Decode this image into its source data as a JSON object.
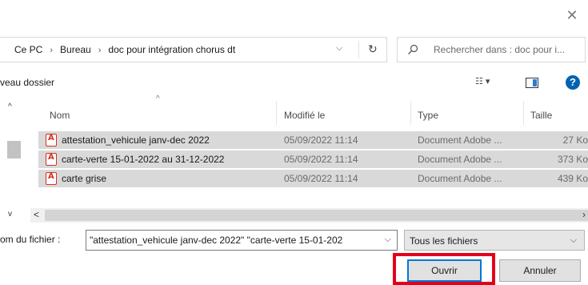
{
  "window": {
    "close_glyph": "✕"
  },
  "address_bar": {
    "crumbs": [
      "Ce PC",
      "Bureau",
      "doc pour intégration chorus dt"
    ],
    "separator": "›",
    "dropdown_glyph": "⌵",
    "refresh_glyph": "↻"
  },
  "search": {
    "placeholder": "Rechercher dans : doc pour i..."
  },
  "toolbar": {
    "new_folder_label": "veau dossier",
    "view_glyph": "☷ ▾",
    "help_glyph": "?"
  },
  "columns": {
    "name": "Nom",
    "modified": "Modifié le",
    "type": "Type",
    "size": "Taille",
    "sort_glyph": "^"
  },
  "files": [
    {
      "name": "attestation_vehicule janv-dec 2022",
      "modified": "05/09/2022 11:14",
      "type": "Document Adobe ...",
      "size": "27 Ko"
    },
    {
      "name": "carte-verte 15-01-2022 au 31-12-2022",
      "modified": "05/09/2022 11:14",
      "type": "Document Adobe ...",
      "size": "373 Ko"
    },
    {
      "name": "carte grise",
      "modified": "05/09/2022 11:14",
      "type": "Document Adobe ...",
      "size": "439 Ko"
    }
  ],
  "nav": {
    "up_glyph": "^",
    "down_glyph": "v"
  },
  "hscroll": {
    "left_glyph": "<",
    "right_glyph": "›"
  },
  "filename": {
    "label": "om du fichier :",
    "value": "\"attestation_vehicule janv-dec 2022\" \"carte-verte 15-01-202",
    "dropdown_glyph": "⌵"
  },
  "filetype": {
    "value": "Tous les fichiers",
    "dropdown_glyph": "⌵"
  },
  "buttons": {
    "open": "Ouvrir",
    "cancel": "Annuler"
  },
  "colors": {
    "highlight": "#e3001b",
    "selection": "#d9d9d9",
    "pdf_icon": "#d6301f",
    "accent": "#0078d7"
  }
}
